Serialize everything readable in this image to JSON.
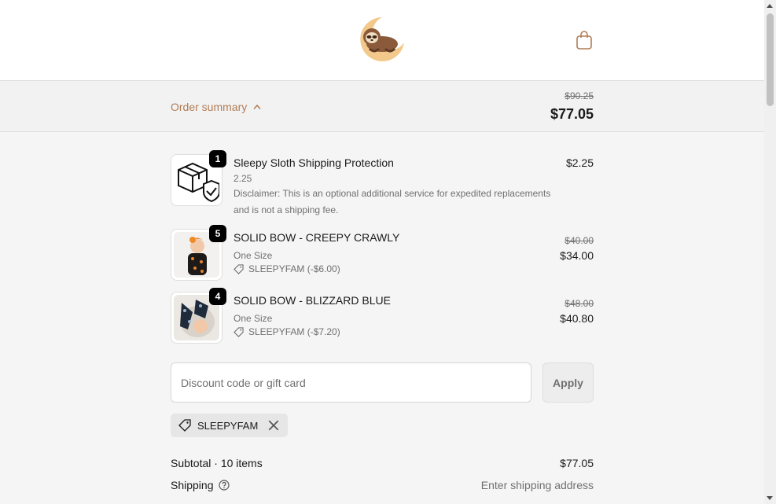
{
  "header": {
    "logo_icon": "sloth-moon-logo-icon",
    "cart_icon": "shopping-bag-icon"
  },
  "order_summary": {
    "toggle_label": "Order summary",
    "toggle_icon": "chevron-up-icon",
    "original_total": "$90.25",
    "total": "$77.05"
  },
  "items": [
    {
      "quantity": "1",
      "title": "Sleepy Sloth Shipping Protection",
      "subtitle": "2.25",
      "disclaimer": "Disclaimer: This is an optional additional service for expedited replacements and is not a shipping fee.",
      "price": "$2.25",
      "image_icon": "package-shield-icon"
    },
    {
      "quantity": "5",
      "title": "SOLID BOW - CREEPY CRAWLY",
      "subtitle": "One Size",
      "discount_code": "SLEEPYFAM (-$6.00)",
      "original_price": "$40.00",
      "price": "$34.00",
      "image_icon": "product-photo-baby-orange-bow"
    },
    {
      "quantity": "4",
      "title": "SOLID BOW - BLIZZARD BLUE",
      "subtitle": "One Size",
      "discount_code": "SLEEPYFAM (-$7.20)",
      "original_price": "$48.00",
      "price": "$40.80",
      "image_icon": "product-photo-baby-blue-bow"
    }
  ],
  "discount": {
    "placeholder": "Discount code or gift card",
    "apply_label": "Apply",
    "applied_code": "SLEEPYFAM"
  },
  "totals": {
    "subtotal_label": "Subtotal · 10 items",
    "subtotal_value": "$77.05",
    "shipping_label": "Shipping",
    "shipping_value": "Enter shipping address"
  },
  "colors": {
    "accent": "#b07d56",
    "background": "#f5f5f5",
    "badge": "#000000"
  }
}
